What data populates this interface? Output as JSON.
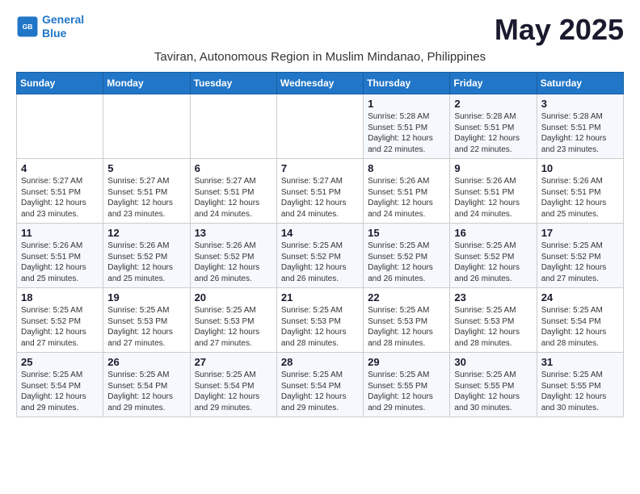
{
  "logo": {
    "line1": "General",
    "line2": "Blue"
  },
  "title": "May 2025",
  "subtitle": "Taviran, Autonomous Region in Muslim Mindanao, Philippines",
  "weekdays": [
    "Sunday",
    "Monday",
    "Tuesday",
    "Wednesday",
    "Thursday",
    "Friday",
    "Saturday"
  ],
  "weeks": [
    [
      {
        "day": "",
        "info": ""
      },
      {
        "day": "",
        "info": ""
      },
      {
        "day": "",
        "info": ""
      },
      {
        "day": "",
        "info": ""
      },
      {
        "day": "1",
        "info": "Sunrise: 5:28 AM\nSunset: 5:51 PM\nDaylight: 12 hours\nand 22 minutes."
      },
      {
        "day": "2",
        "info": "Sunrise: 5:28 AM\nSunset: 5:51 PM\nDaylight: 12 hours\nand 22 minutes."
      },
      {
        "day": "3",
        "info": "Sunrise: 5:28 AM\nSunset: 5:51 PM\nDaylight: 12 hours\nand 23 minutes."
      }
    ],
    [
      {
        "day": "4",
        "info": "Sunrise: 5:27 AM\nSunset: 5:51 PM\nDaylight: 12 hours\nand 23 minutes."
      },
      {
        "day": "5",
        "info": "Sunrise: 5:27 AM\nSunset: 5:51 PM\nDaylight: 12 hours\nand 23 minutes."
      },
      {
        "day": "6",
        "info": "Sunrise: 5:27 AM\nSunset: 5:51 PM\nDaylight: 12 hours\nand 24 minutes."
      },
      {
        "day": "7",
        "info": "Sunrise: 5:27 AM\nSunset: 5:51 PM\nDaylight: 12 hours\nand 24 minutes."
      },
      {
        "day": "8",
        "info": "Sunrise: 5:26 AM\nSunset: 5:51 PM\nDaylight: 12 hours\nand 24 minutes."
      },
      {
        "day": "9",
        "info": "Sunrise: 5:26 AM\nSunset: 5:51 PM\nDaylight: 12 hours\nand 24 minutes."
      },
      {
        "day": "10",
        "info": "Sunrise: 5:26 AM\nSunset: 5:51 PM\nDaylight: 12 hours\nand 25 minutes."
      }
    ],
    [
      {
        "day": "11",
        "info": "Sunrise: 5:26 AM\nSunset: 5:51 PM\nDaylight: 12 hours\nand 25 minutes."
      },
      {
        "day": "12",
        "info": "Sunrise: 5:26 AM\nSunset: 5:52 PM\nDaylight: 12 hours\nand 25 minutes."
      },
      {
        "day": "13",
        "info": "Sunrise: 5:26 AM\nSunset: 5:52 PM\nDaylight: 12 hours\nand 26 minutes."
      },
      {
        "day": "14",
        "info": "Sunrise: 5:25 AM\nSunset: 5:52 PM\nDaylight: 12 hours\nand 26 minutes."
      },
      {
        "day": "15",
        "info": "Sunrise: 5:25 AM\nSunset: 5:52 PM\nDaylight: 12 hours\nand 26 minutes."
      },
      {
        "day": "16",
        "info": "Sunrise: 5:25 AM\nSunset: 5:52 PM\nDaylight: 12 hours\nand 26 minutes."
      },
      {
        "day": "17",
        "info": "Sunrise: 5:25 AM\nSunset: 5:52 PM\nDaylight: 12 hours\nand 27 minutes."
      }
    ],
    [
      {
        "day": "18",
        "info": "Sunrise: 5:25 AM\nSunset: 5:52 PM\nDaylight: 12 hours\nand 27 minutes."
      },
      {
        "day": "19",
        "info": "Sunrise: 5:25 AM\nSunset: 5:53 PM\nDaylight: 12 hours\nand 27 minutes."
      },
      {
        "day": "20",
        "info": "Sunrise: 5:25 AM\nSunset: 5:53 PM\nDaylight: 12 hours\nand 27 minutes."
      },
      {
        "day": "21",
        "info": "Sunrise: 5:25 AM\nSunset: 5:53 PM\nDaylight: 12 hours\nand 28 minutes."
      },
      {
        "day": "22",
        "info": "Sunrise: 5:25 AM\nSunset: 5:53 PM\nDaylight: 12 hours\nand 28 minutes."
      },
      {
        "day": "23",
        "info": "Sunrise: 5:25 AM\nSunset: 5:53 PM\nDaylight: 12 hours\nand 28 minutes."
      },
      {
        "day": "24",
        "info": "Sunrise: 5:25 AM\nSunset: 5:54 PM\nDaylight: 12 hours\nand 28 minutes."
      }
    ],
    [
      {
        "day": "25",
        "info": "Sunrise: 5:25 AM\nSunset: 5:54 PM\nDaylight: 12 hours\nand 29 minutes."
      },
      {
        "day": "26",
        "info": "Sunrise: 5:25 AM\nSunset: 5:54 PM\nDaylight: 12 hours\nand 29 minutes."
      },
      {
        "day": "27",
        "info": "Sunrise: 5:25 AM\nSunset: 5:54 PM\nDaylight: 12 hours\nand 29 minutes."
      },
      {
        "day": "28",
        "info": "Sunrise: 5:25 AM\nSunset: 5:54 PM\nDaylight: 12 hours\nand 29 minutes."
      },
      {
        "day": "29",
        "info": "Sunrise: 5:25 AM\nSunset: 5:55 PM\nDaylight: 12 hours\nand 29 minutes."
      },
      {
        "day": "30",
        "info": "Sunrise: 5:25 AM\nSunset: 5:55 PM\nDaylight: 12 hours\nand 30 minutes."
      },
      {
        "day": "31",
        "info": "Sunrise: 5:25 AM\nSunset: 5:55 PM\nDaylight: 12 hours\nand 30 minutes."
      }
    ]
  ]
}
